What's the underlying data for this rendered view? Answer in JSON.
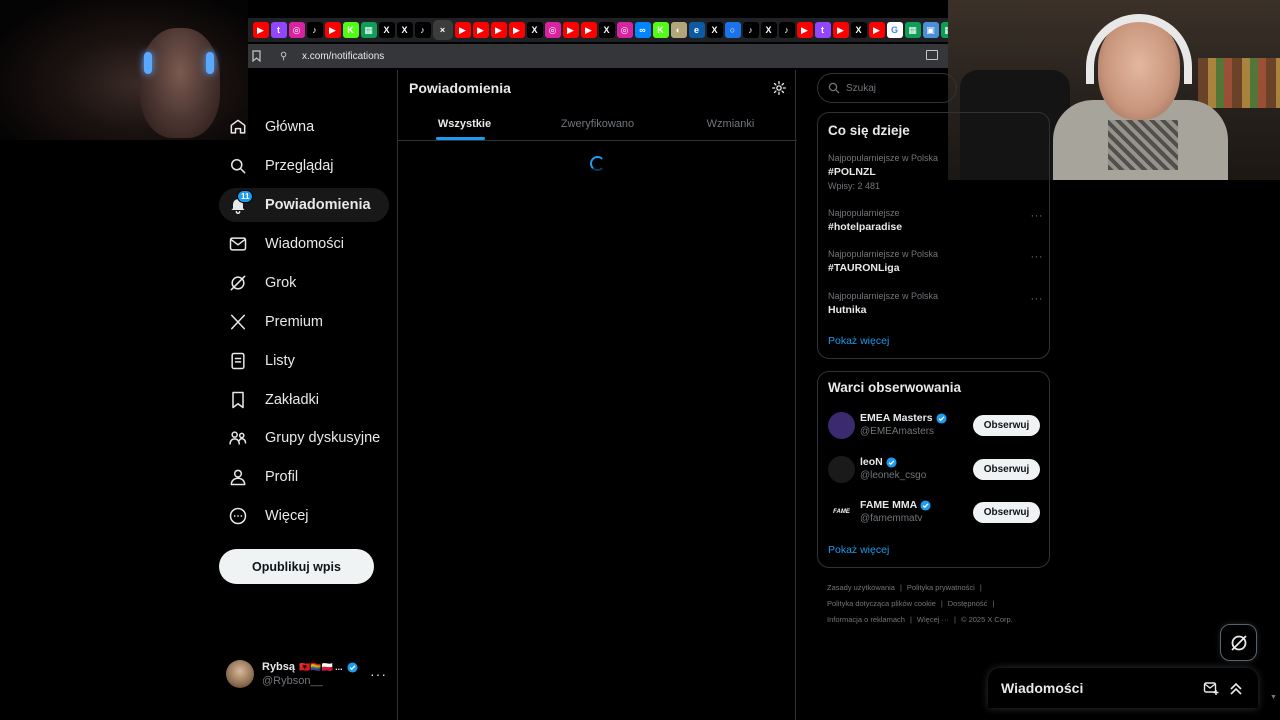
{
  "browser": {
    "url": "x.com/notifications",
    "tabs": [
      {
        "icon": "youtube-icon",
        "color": "#ff0000",
        "glyph": "▶"
      },
      {
        "icon": "twitch-icon",
        "color": "#9146ff",
        "glyph": "t"
      },
      {
        "icon": "instagram-icon",
        "color": "#d6249f",
        "glyph": "◎"
      },
      {
        "icon": "tiktok-icon",
        "color": "#000000",
        "glyph": "♪"
      },
      {
        "icon": "youtube-icon",
        "color": "#ff0000",
        "glyph": "▶"
      },
      {
        "icon": "kick-icon",
        "color": "#53fc18",
        "glyph": "K"
      },
      {
        "icon": "sheets-icon",
        "color": "#0f9d58",
        "glyph": "▦"
      },
      {
        "icon": "x-icon",
        "color": "#000000",
        "glyph": "X"
      },
      {
        "icon": "x-icon",
        "color": "#000000",
        "glyph": "X"
      },
      {
        "icon": "tiktok-icon",
        "color": "#000000",
        "glyph": "♪"
      },
      {
        "icon": "active-tab-close-icon",
        "color": "#3c3c3c",
        "glyph": "×",
        "active": true
      },
      {
        "icon": "youtube-icon",
        "color": "#ff0000",
        "glyph": "▶"
      },
      {
        "icon": "youtube-icon",
        "color": "#ff0000",
        "glyph": "▶"
      },
      {
        "icon": "youtube-icon",
        "color": "#ff0000",
        "glyph": "▶"
      },
      {
        "icon": "youtube-icon",
        "color": "#ff0000",
        "glyph": "▶"
      },
      {
        "icon": "x-icon",
        "color": "#000000",
        "glyph": "X"
      },
      {
        "icon": "instagram-icon",
        "color": "#d6249f",
        "glyph": "◎"
      },
      {
        "icon": "youtube-icon",
        "color": "#ff0000",
        "glyph": "▶"
      },
      {
        "icon": "youtube-icon",
        "color": "#ff0000",
        "glyph": "▶"
      },
      {
        "icon": "x-icon",
        "color": "#000000",
        "glyph": "X"
      },
      {
        "icon": "instagram-icon",
        "color": "#d6249f",
        "glyph": "◎"
      },
      {
        "icon": "messenger-icon",
        "color": "#0084ff",
        "glyph": "∞"
      },
      {
        "icon": "kick-icon",
        "color": "#53fc18",
        "glyph": "K"
      },
      {
        "icon": "egg-icon",
        "color": "#b5a57a",
        "glyph": "◐"
      },
      {
        "icon": "edge-icon",
        "color": "#0c59a4",
        "glyph": "e"
      },
      {
        "icon": "x-icon",
        "color": "#000000",
        "glyph": "X"
      },
      {
        "icon": "loading-icon",
        "color": "#1a73e8",
        "glyph": "○"
      },
      {
        "icon": "tiktok-icon",
        "color": "#000000",
        "glyph": "♪"
      },
      {
        "icon": "x-icon",
        "color": "#000000",
        "glyph": "X"
      },
      {
        "icon": "tiktok-icon",
        "color": "#000000",
        "glyph": "♪"
      },
      {
        "icon": "youtube-icon",
        "color": "#ff0000",
        "glyph": "▶"
      },
      {
        "icon": "twitch-icon",
        "color": "#9146ff",
        "glyph": "t"
      },
      {
        "icon": "youtube-icon",
        "color": "#ff0000",
        "glyph": "▶"
      },
      {
        "icon": "x-icon",
        "color": "#000000",
        "glyph": "X"
      },
      {
        "icon": "youtube-icon",
        "color": "#ff0000",
        "glyph": "▶"
      },
      {
        "icon": "google-icon",
        "color": "#ffffff",
        "glyph": "G"
      },
      {
        "icon": "sheets-icon",
        "color": "#0f9d58",
        "glyph": "▦"
      },
      {
        "icon": "tab-icon",
        "color": "#4a90d9",
        "glyph": "▣"
      },
      {
        "icon": "sheets-icon",
        "color": "#0f9d58",
        "glyph": "▦"
      },
      {
        "icon": "x-icon",
        "color": "#000000",
        "glyph": "X"
      },
      {
        "icon": "globe-icon",
        "color": "#5f6368",
        "glyph": "◍"
      },
      {
        "icon": "tab-icon",
        "color": "#4a90d9",
        "glyph": "▣"
      },
      {
        "icon": "youtube-icon",
        "color": "#ff0000",
        "glyph": "▶"
      }
    ]
  },
  "nav": {
    "items": [
      {
        "label": "Główna",
        "icon": "home-icon",
        "name": "nav-home"
      },
      {
        "label": "Przeglądaj",
        "icon": "search-icon",
        "name": "nav-explore"
      },
      {
        "label": "Powiadomienia",
        "icon": "bell-icon",
        "name": "nav-notifications",
        "active": true,
        "badge": "11"
      },
      {
        "label": "Wiadomości",
        "icon": "envelope-icon",
        "name": "nav-messages"
      },
      {
        "label": "Grok",
        "icon": "grok-icon",
        "name": "nav-grok"
      },
      {
        "label": "Premium",
        "icon": "x-logo-icon",
        "name": "nav-premium"
      },
      {
        "label": "Listy",
        "icon": "list-icon",
        "name": "nav-lists"
      },
      {
        "label": "Zakładki",
        "icon": "bookmark-icon",
        "name": "nav-bookmarks"
      },
      {
        "label": "Grupy dyskusyjne",
        "icon": "communities-icon",
        "name": "nav-communities"
      },
      {
        "label": "Profil",
        "icon": "person-icon",
        "name": "nav-profile"
      },
      {
        "label": "Więcej",
        "icon": "more-circle-icon",
        "name": "nav-more"
      }
    ],
    "post_button": "Opublikuj wpis",
    "account": {
      "display_name": "Rybsą",
      "flags": "🇦🇱🏳️‍🌈🇵🇱 ...",
      "handle": "@Rybson__",
      "more": "···"
    }
  },
  "main": {
    "title": "Powiadomienia",
    "tabs": [
      {
        "label": "Wszystkie",
        "active": true
      },
      {
        "label": "Zweryfikowano"
      },
      {
        "label": "Wzmianki"
      }
    ]
  },
  "sidebar": {
    "search_placeholder": "Szukaj",
    "trends": {
      "title": "Co się dzieje",
      "items": [
        {
          "context": "Najpopularniejsze w Polska",
          "name": "#POLNZL",
          "count": "Wpisy: 2 481"
        },
        {
          "context": "Najpopularniejsze",
          "name": "#hotelparadise",
          "count": ""
        },
        {
          "context": "Najpopularniejsze w Polska",
          "name": "#TAURONLiga",
          "count": ""
        },
        {
          "context": "Najpopularniejsze w Polska",
          "name": "Hutnika",
          "count": ""
        }
      ],
      "more": "Pokaż więcej"
    },
    "who_to_follow": {
      "title": "Warci obserwowania",
      "items": [
        {
          "name": "EMEA Masters",
          "handle": "@EMEAmasters",
          "button": "Obserwuj",
          "avatar_color": "#3b2a6e",
          "avatar_text": ""
        },
        {
          "name": "leoN",
          "handle": "@leonek_csgo",
          "button": "Obserwuj",
          "avatar_color": "#1a1a1a",
          "avatar_text": ""
        },
        {
          "name": "FAME MMA",
          "handle": "@famemmatv",
          "button": "Obserwuj",
          "avatar_color": "#000000",
          "avatar_text": "FAME"
        }
      ],
      "more": "Pokaż więcej"
    },
    "footer": [
      "Zasady użytkowania",
      "Polityka prywatności",
      "Polityka dotycząca plików cookie",
      "Dostępność",
      "Informacja o reklamach",
      "Więcej ···",
      "© 2025 X Corp."
    ]
  },
  "messages_drawer": {
    "title": "Wiadomości"
  },
  "colors": {
    "accent": "#1d9bf0",
    "background": "#000000",
    "border": "#2f3336",
    "muted": "#71767b"
  }
}
